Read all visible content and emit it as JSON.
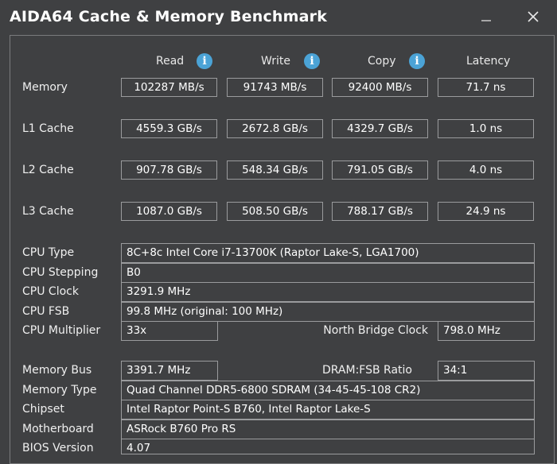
{
  "window": {
    "title": "AIDA64 Cache & Memory Benchmark"
  },
  "columns": {
    "read": "Read",
    "write": "Write",
    "copy": "Copy",
    "latency": "Latency"
  },
  "bench": [
    {
      "label": "Memory",
      "read": "102287 MB/s",
      "write": "91743 MB/s",
      "copy": "92400 MB/s",
      "latency": "71.7 ns"
    },
    {
      "label": "L1 Cache",
      "read": "4559.3 GB/s",
      "write": "2672.8 GB/s",
      "copy": "4329.7 GB/s",
      "latency": "1.0 ns"
    },
    {
      "label": "L2 Cache",
      "read": "907.78 GB/s",
      "write": "548.34 GB/s",
      "copy": "791.05 GB/s",
      "latency": "4.0 ns"
    },
    {
      "label": "L3 Cache",
      "read": "1087.0 GB/s",
      "write": "508.50 GB/s",
      "copy": "788.17 GB/s",
      "latency": "24.9 ns"
    }
  ],
  "info": {
    "cpu_type": {
      "label": "CPU Type",
      "value": "8C+8c Intel Core i7-13700K  (Raptor Lake-S, LGA1700)"
    },
    "cpu_stepping": {
      "label": "CPU Stepping",
      "value": "B0"
    },
    "cpu_clock": {
      "label": "CPU Clock",
      "value": "3291.9 MHz"
    },
    "cpu_fsb": {
      "label": "CPU FSB",
      "value": "99.8 MHz  (original: 100 MHz)"
    },
    "cpu_multiplier": {
      "label": "CPU Multiplier",
      "value": "33x"
    },
    "north_bridge_clock": {
      "label": "North Bridge Clock",
      "value": "798.0 MHz"
    },
    "memory_bus": {
      "label": "Memory Bus",
      "value": "3391.7 MHz"
    },
    "dram_fsb_ratio": {
      "label": "DRAM:FSB Ratio",
      "value": "34:1"
    },
    "memory_type": {
      "label": "Memory Type",
      "value": "Quad Channel DDR5-6800 SDRAM  (34-45-45-108 CR2)"
    },
    "chipset": {
      "label": "Chipset",
      "value": "Intel Raptor Point-S B760, Intel Raptor Lake-S"
    },
    "motherboard": {
      "label": "Motherboard",
      "value": "ASRock B760 Pro RS"
    },
    "bios_version": {
      "label": "BIOS Version",
      "value": "4.07"
    }
  },
  "icons": {
    "info": "info-icon",
    "minimize": "minimize-icon",
    "close": "close-icon"
  },
  "colors": {
    "background": "#3f4042",
    "border": "#9a9b9d",
    "info_accent": "#4ba3d6"
  }
}
